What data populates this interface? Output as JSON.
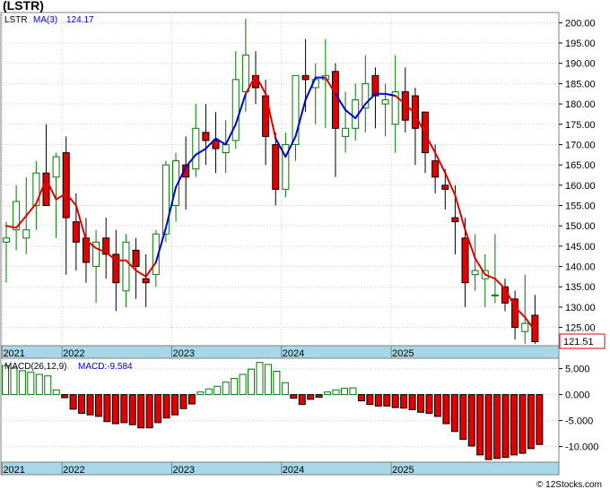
{
  "title": "(LSTR)",
  "legend": {
    "ticker": "LSTR",
    "ma_label": "MA(3)",
    "ma_value": "124.17",
    "macd_params": "MACD(26,12,9)",
    "macd_value": "MACD:-9.584"
  },
  "last_price_tag": "121.51",
  "watermark": "© 12Stocks.com",
  "colors": {
    "up_fill": "#ffffff",
    "up_stroke": "#007a00",
    "down_fill": "#e00000",
    "ma_up": "#0000cc",
    "ma_down": "#e00000",
    "axis_band": "#a8d8e8",
    "grid": "#cccccc"
  },
  "chart_data": [
    {
      "type": "candlestick",
      "ylim": [
        120.5,
        202.5
      ],
      "yticks": [
        "125.00",
        "130.00",
        "135.00",
        "140.00",
        "145.00",
        "150.00",
        "155.00",
        "160.00",
        "165.00",
        "170.00",
        "175.00",
        "180.00",
        "185.00",
        "190.00",
        "195.00",
        "200.00"
      ],
      "x_labels": [
        "2021",
        "2022",
        "2023",
        "2024",
        "2025"
      ],
      "label_index": [
        0,
        6,
        17,
        28,
        39
      ],
      "ohlc": [
        [
          146,
          151,
          136,
          147
        ],
        [
          149,
          160,
          144,
          156
        ],
        [
          147,
          162,
          143,
          149
        ],
        [
          155,
          166,
          149,
          163
        ],
        [
          163,
          175,
          158,
          155
        ],
        [
          162,
          168,
          147,
          167
        ],
        [
          168,
          172,
          138,
          152
        ],
        [
          151,
          158,
          139,
          146
        ],
        [
          147,
          152,
          136,
          141
        ],
        [
          140,
          149,
          131,
          146
        ],
        [
          147,
          152,
          137,
          143
        ],
        [
          143,
          149,
          129,
          136
        ],
        [
          134,
          148,
          130,
          146
        ],
        [
          144,
          147,
          132,
          140
        ],
        [
          137,
          143,
          130,
          136
        ],
        [
          138,
          149,
          135,
          148
        ],
        [
          148,
          166,
          146,
          165
        ],
        [
          155,
          168,
          151,
          166
        ],
        [
          165,
          172,
          154,
          162
        ],
        [
          164,
          180,
          162,
          174
        ],
        [
          173,
          180,
          165,
          171
        ],
        [
          171,
          178,
          163,
          169
        ],
        [
          168,
          176,
          163,
          170
        ],
        [
          171,
          193,
          169,
          186
        ],
        [
          183,
          201,
          178,
          192
        ],
        [
          187,
          193,
          180,
          184
        ],
        [
          182,
          186,
          165,
          172
        ],
        [
          170,
          173,
          155,
          159
        ],
        [
          159,
          173,
          157,
          170
        ],
        [
          170,
          187,
          166,
          187
        ],
        [
          187,
          196,
          178,
          186
        ],
        [
          184,
          190,
          175,
          186
        ],
        [
          186,
          196,
          174,
          187
        ],
        [
          188,
          190,
          162,
          174
        ],
        [
          172,
          183,
          168,
          174
        ],
        [
          174,
          185,
          171,
          181
        ],
        [
          179,
          192,
          173,
          185
        ],
        [
          187,
          189,
          174,
          182
        ],
        [
          180,
          185,
          172,
          181
        ],
        [
          175,
          192,
          168,
          183
        ],
        [
          183,
          189,
          173,
          176
        ],
        [
          182,
          184,
          165,
          174
        ],
        [
          178,
          176,
          163,
          168
        ],
        [
          166,
          170,
          158,
          162
        ],
        [
          160,
          164,
          154,
          159
        ],
        [
          152,
          160,
          143,
          151
        ],
        [
          147,
          152,
          130,
          136
        ],
        [
          138,
          148,
          134,
          139
        ],
        [
          137,
          143,
          130,
          139
        ],
        [
          133,
          148,
          131,
          133
        ],
        [
          135,
          137,
          129,
          131
        ],
        [
          132,
          134,
          122,
          125
        ],
        [
          124,
          138,
          121,
          126
        ],
        [
          128,
          133,
          121,
          121.5
        ]
      ],
      "ma": [
        150,
        149.5,
        152.5,
        155.5,
        161.5,
        156.5,
        158,
        155,
        146.5,
        144.5,
        143.5,
        141.5,
        141.5,
        139,
        137.5,
        141,
        149.5,
        159.5,
        164.5,
        167.5,
        169,
        171.5,
        170,
        175,
        182.5,
        187,
        182.5,
        171.5,
        167,
        172,
        181,
        186.5,
        186.5,
        182.5,
        178.5,
        176.5,
        180,
        182.5,
        182.5,
        182,
        180,
        177.5,
        172.5,
        168,
        163,
        157.5,
        149,
        142,
        138,
        137,
        134.5,
        130,
        127.5,
        124.17
      ],
      "ma_color": [
        "d",
        "d",
        "d",
        "d",
        "d",
        "d",
        "d",
        "d",
        "d",
        "d",
        "d",
        "d",
        "d",
        "d",
        "d",
        "d",
        "u",
        "u",
        "u",
        "u",
        "u",
        "u",
        "u",
        "u",
        "u",
        "d",
        "d",
        "d",
        "u",
        "u",
        "u",
        "u",
        "u",
        "d",
        "u",
        "u",
        "u",
        "u",
        "u",
        "u",
        "d",
        "d",
        "d",
        "d",
        "d",
        "d",
        "d",
        "d",
        "d",
        "d",
        "d",
        "d",
        "d",
        "d"
      ]
    },
    {
      "type": "bar",
      "ylim": [
        -13,
        7
      ],
      "yticks": [
        "5.000",
        "0.000",
        "-5.000",
        "-10.000"
      ],
      "ytick_values": [
        5,
        0,
        -5,
        -10
      ],
      "x_labels": [
        "2021",
        "2022",
        "2023",
        "2024",
        "2025"
      ],
      "values": [
        5.6,
        5.1,
        4.6,
        4.3,
        3.9,
        3.6,
        0.9,
        -0.6,
        -2.8,
        -3.6,
        -3.9,
        -4.2,
        -5.2,
        -5.6,
        -5.4,
        -5.8,
        -6.4,
        -6.4,
        -5.4,
        -4.5,
        -3.9,
        -2.7,
        -1.8,
        0.5,
        1.1,
        1.6,
        2.4,
        3.1,
        3.9,
        4.9,
        6.2,
        5.8,
        4.5,
        2.3,
        -0.7,
        -1.9,
        -0.9,
        -0.5,
        0.5,
        0.9,
        1.2,
        1.3,
        -1.2,
        -1.9,
        -2.2,
        -2.2,
        -2.5,
        -2.6,
        -2.9,
        -3.4,
        -3.6,
        -4.2,
        -5.6,
        -7.1,
        -8.6,
        -9.9,
        -11.6,
        -12.5,
        -12.3,
        -12.1,
        -11.6,
        -11.3,
        -10.4,
        -9.6
      ]
    }
  ]
}
